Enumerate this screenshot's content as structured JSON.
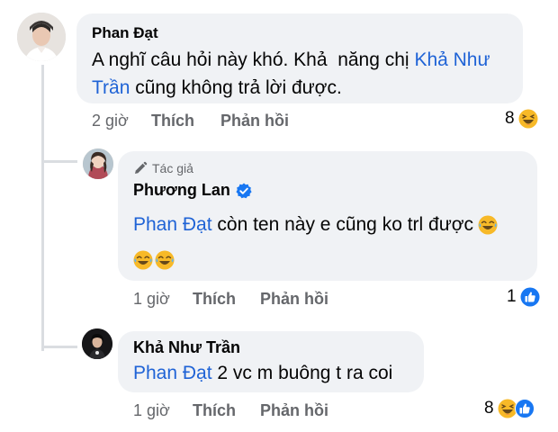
{
  "comments": [
    {
      "author": "Phan Đạt",
      "text_line1": "A nghĩ câu hỏi này khó. Khả  năng chị ",
      "mention_line1": "Khả Như",
      "mention_line2": "Trần",
      "text_line2": " cũng không trả lời được.",
      "time": "2 giờ",
      "like_label": "Thích",
      "reply_label": "Phản hồi",
      "reaction_count": "8",
      "reaction_icons": [
        "haha-icon"
      ]
    },
    {
      "badge": "Tác giả",
      "author": "Phương Lan",
      "verified": true,
      "mention": "Phan Đạt",
      "text": " còn ten này e cũng ko trl được",
      "emoji_line1": [
        "sweat-smile-icon"
      ],
      "emoji_line2": [
        "sweat-smile-icon",
        "sweat-smile-icon"
      ],
      "time": "1 giờ",
      "like_label": "Thích",
      "reply_label": "Phản hồi",
      "reaction_count": "1",
      "reaction_icons": [
        "like-icon"
      ]
    },
    {
      "author": "Khả Như Trần",
      "mention": "Phan Đạt",
      "text": " 2 vc m buông t ra coi",
      "time": "1 giờ",
      "like_label": "Thích",
      "reply_label": "Phản hồi",
      "reaction_count": "8",
      "reaction_icons": [
        "haha-icon",
        "like-icon"
      ]
    }
  ],
  "colors": {
    "bubble": "#f0f2f5",
    "mention": "#1f63d6",
    "meta": "#65676b",
    "like_blue": "#1877f2",
    "haha_yellow": "#f7b928"
  }
}
